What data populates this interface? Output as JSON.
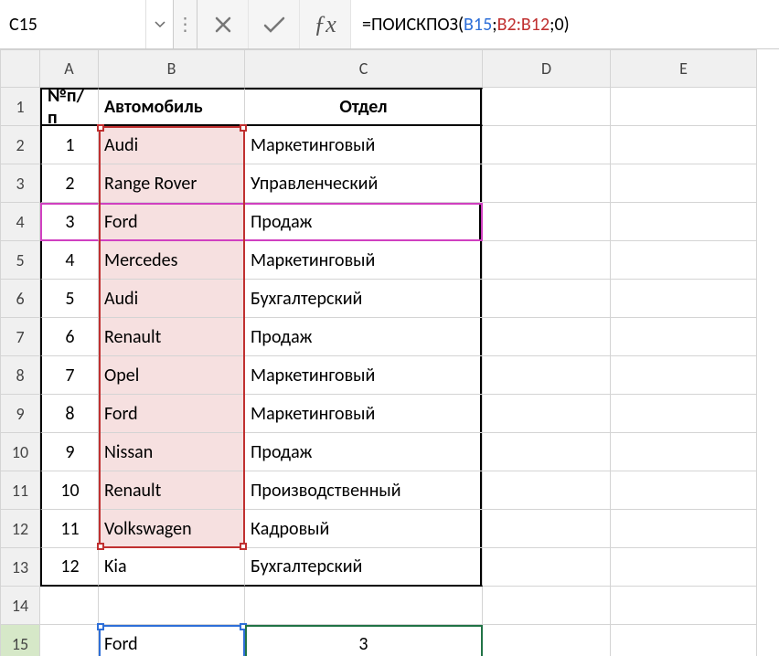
{
  "name_box": "C15",
  "formula": {
    "prefix": "=",
    "fn": "ПОИСКПОЗ",
    "open": "(",
    "arg1": "B15",
    "sep1": ";",
    "arg2": "B2:B12",
    "sep2": ";",
    "arg3": "0",
    "close": ")"
  },
  "columns": [
    "A",
    "B",
    "C",
    "D",
    "E"
  ],
  "row_numbers": [
    "1",
    "2",
    "3",
    "4",
    "5",
    "6",
    "7",
    "8",
    "9",
    "10",
    "11",
    "12",
    "13",
    "14",
    "15"
  ],
  "active_row": "15",
  "headers": {
    "a": "№п/п",
    "b": "Автомобиль",
    "c": "Отдел"
  },
  "rows": [
    {
      "n": "1",
      "car": "Audi",
      "dept": "Маркетинговый"
    },
    {
      "n": "2",
      "car": "Range Rover",
      "dept": "Управленческий"
    },
    {
      "n": "3",
      "car": "Ford",
      "dept": "Продаж"
    },
    {
      "n": "4",
      "car": "Mercedes",
      "dept": "Маркетинговый"
    },
    {
      "n": "5",
      "car": "Audi",
      "dept": "Бухгалтерский"
    },
    {
      "n": "6",
      "car": "Renault",
      "dept": "Продаж"
    },
    {
      "n": "7",
      "car": "Opel",
      "dept": "Маркетинговый"
    },
    {
      "n": "8",
      "car": "Ford",
      "dept": "Маркетинговый"
    },
    {
      "n": "9",
      "car": "Nissan",
      "dept": "Продаж"
    },
    {
      "n": "10",
      "car": "Renault",
      "dept": "Производственный"
    },
    {
      "n": "11",
      "car": "Volkswagen",
      "dept": "Кадровый"
    },
    {
      "n": "12",
      "car": "Kia",
      "dept": "Бухгалтерский"
    }
  ],
  "lookup": {
    "b15": "Ford",
    "c15": "3"
  }
}
